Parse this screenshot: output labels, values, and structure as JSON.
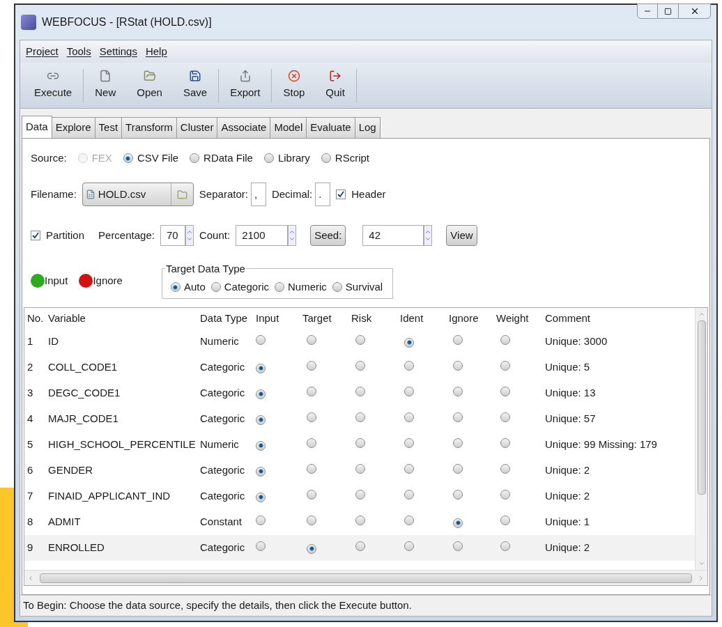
{
  "window": {
    "title": "WEBFOCUS - [RStat (HOLD.csv)]"
  },
  "menu": [
    {
      "label": "Project"
    },
    {
      "label": "Tools"
    },
    {
      "label": "Settings"
    },
    {
      "label": "Help"
    }
  ],
  "toolbar": [
    {
      "label": "Execute",
      "kind": "execute"
    },
    {
      "label": "New",
      "kind": "new"
    },
    {
      "label": "Open",
      "kind": "open"
    },
    {
      "label": "Save",
      "kind": "save"
    },
    {
      "label": "Export",
      "kind": "export"
    },
    {
      "label": "Stop",
      "kind": "stop"
    },
    {
      "label": "Quit",
      "kind": "quit"
    }
  ],
  "tabs": [
    {
      "label": "Data",
      "selected": true
    },
    {
      "label": "Explore",
      "selected": false
    },
    {
      "label": "Test",
      "selected": false
    },
    {
      "label": "Transform",
      "selected": false
    },
    {
      "label": "Cluster",
      "selected": false
    },
    {
      "label": "Associate",
      "selected": false
    },
    {
      "label": "Model",
      "selected": false
    },
    {
      "label": "Evaluate",
      "selected": false
    },
    {
      "label": "Log",
      "selected": false
    }
  ],
  "source": {
    "label": "Source:",
    "options": [
      {
        "label": "FEX",
        "selected": false,
        "disabled": true
      },
      {
        "label": "CSV File",
        "selected": true,
        "disabled": false
      },
      {
        "label": "RData File",
        "selected": false,
        "disabled": false
      },
      {
        "label": "Library",
        "selected": false,
        "disabled": false
      },
      {
        "label": "RScript",
        "selected": false,
        "disabled": false
      }
    ]
  },
  "file": {
    "label": "Filename:",
    "value": "HOLD.csv",
    "separator_label": "Separator:",
    "separator": ",",
    "decimal_label": "Decimal:",
    "decimal": ".",
    "header": {
      "label": "Header",
      "checked": true
    }
  },
  "partition": {
    "label": "Partition",
    "checked": true,
    "percentage_label": "Percentage:",
    "percentage": "70",
    "count_label": "Count:",
    "count": "2100",
    "seed_button": "Seed:",
    "seed": "42",
    "view_button": "View"
  },
  "legend": [
    {
      "label": "Input",
      "color": "#2faa1e"
    },
    {
      "label": "Ignore",
      "color": "#d41010"
    }
  ],
  "target_type": {
    "title": "Target Data Type",
    "options": [
      {
        "label": "Auto",
        "selected": true
      },
      {
        "label": "Categoric",
        "selected": false
      },
      {
        "label": "Numeric",
        "selected": false
      },
      {
        "label": "Survival",
        "selected": false
      }
    ]
  },
  "table": {
    "columns": [
      "No.",
      "Variable",
      "Data Type",
      "Input",
      "Target",
      "Risk",
      "Ident",
      "Ignore",
      "Weight",
      "Comment"
    ],
    "rows": [
      {
        "no": "1",
        "variable": "ID",
        "type": "Numeric",
        "roles": [
          {
            "selected": false
          },
          {
            "selected": false
          },
          {
            "selected": false
          },
          {
            "selected": true
          },
          {
            "selected": false
          },
          {
            "selected": false
          }
        ],
        "comment": "Unique: 3000"
      },
      {
        "no": "2",
        "variable": "COLL_CODE1",
        "type": "Categoric",
        "roles": [
          {
            "selected": true
          },
          {
            "selected": false
          },
          {
            "selected": false
          },
          {
            "selected": false
          },
          {
            "selected": false
          },
          {
            "selected": false
          }
        ],
        "comment": "Unique: 5"
      },
      {
        "no": "3",
        "variable": "DEGC_CODE1",
        "type": "Categoric",
        "roles": [
          {
            "selected": true
          },
          {
            "selected": false
          },
          {
            "selected": false
          },
          {
            "selected": false
          },
          {
            "selected": false
          },
          {
            "selected": false
          }
        ],
        "comment": "Unique: 13"
      },
      {
        "no": "4",
        "variable": "MAJR_CODE1",
        "type": "Categoric",
        "roles": [
          {
            "selected": true
          },
          {
            "selected": false
          },
          {
            "selected": false
          },
          {
            "selected": false
          },
          {
            "selected": false
          },
          {
            "selected": false
          }
        ],
        "comment": "Unique: 57"
      },
      {
        "no": "5",
        "variable": "HIGH_SCHOOL_PERCENTILE",
        "type": "Numeric",
        "roles": [
          {
            "selected": true
          },
          {
            "selected": false
          },
          {
            "selected": false
          },
          {
            "selected": false
          },
          {
            "selected": false
          },
          {
            "selected": false
          }
        ],
        "comment": "Unique: 99 Missing: 179"
      },
      {
        "no": "6",
        "variable": "GENDER",
        "type": "Categoric",
        "roles": [
          {
            "selected": true
          },
          {
            "selected": false
          },
          {
            "selected": false
          },
          {
            "selected": false
          },
          {
            "selected": false
          },
          {
            "selected": false
          }
        ],
        "comment": "Unique: 2"
      },
      {
        "no": "7",
        "variable": "FINAID_APPLICANT_IND",
        "type": "Categoric",
        "roles": [
          {
            "selected": true
          },
          {
            "selected": false
          },
          {
            "selected": false
          },
          {
            "selected": false
          },
          {
            "selected": false
          },
          {
            "selected": false
          }
        ],
        "comment": "Unique: 2"
      },
      {
        "no": "8",
        "variable": "ADMIT",
        "type": "Constant",
        "roles": [
          {
            "selected": false
          },
          {
            "selected": false
          },
          {
            "selected": false
          },
          {
            "selected": false
          },
          {
            "selected": true
          },
          {
            "selected": false
          }
        ],
        "comment": "Unique: 1"
      },
      {
        "no": "9",
        "variable": "ENROLLED",
        "type": "Categoric",
        "roles": [
          {
            "selected": false
          },
          {
            "selected": true
          },
          {
            "selected": false
          },
          {
            "selected": false
          },
          {
            "selected": false
          },
          {
            "selected": false
          }
        ],
        "comment": "Unique: 2"
      }
    ]
  },
  "status_bar": "To Begin: Choose the data source, specify the details, then click the Execute button."
}
